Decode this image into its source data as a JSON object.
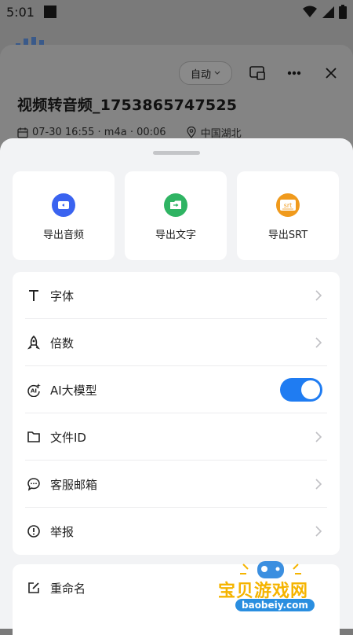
{
  "status_bar": {
    "time": "5:01"
  },
  "header": {
    "mode_button": "自动",
    "title": "视频转音频_1753865747525",
    "meta": {
      "date": "07-30 16:55",
      "format": "m4a",
      "duration": "00:06",
      "location": "中国湖北"
    }
  },
  "export": {
    "items": [
      {
        "label": "导出音频",
        "color": "#3a63f0",
        "icon": "audio-export-icon"
      },
      {
        "label": "导出文字",
        "color": "#2fb463",
        "icon": "text-export-icon"
      },
      {
        "label": "导出SRT",
        "color": "#f09a1c",
        "icon": "srt-icon",
        "icon_text": "srt"
      }
    ]
  },
  "menu": {
    "items": [
      {
        "label": "字体",
        "icon": "font-icon",
        "type": "link"
      },
      {
        "label": "倍数",
        "icon": "rocket-icon",
        "type": "link"
      },
      {
        "label": "AI大模型",
        "icon": "ai-icon",
        "type": "toggle",
        "enabled": true
      },
      {
        "label": "文件ID",
        "icon": "folder-icon",
        "type": "link"
      },
      {
        "label": "客服邮箱",
        "icon": "chat-icon",
        "type": "link"
      },
      {
        "label": "举报",
        "icon": "alert-icon",
        "type": "link"
      }
    ],
    "rename_label": "重命名"
  },
  "watermark": {
    "text": "宝贝游戏网",
    "url": "baobeiy.com"
  },
  "colors": {
    "accent": "#1f7cf2",
    "sheet_bg": "#f2f3f5",
    "overlay": "#7a7a7a"
  }
}
